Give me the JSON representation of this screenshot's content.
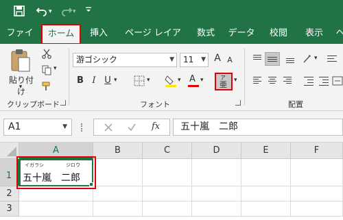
{
  "quick_access": {
    "save": "save-icon",
    "undo": "undo-icon",
    "redo": "redo-icon",
    "customize": "customize-qat-icon"
  },
  "tabs": [
    "ファイル",
    "ホーム",
    "挿入",
    "ページ レイアウト",
    "数式",
    "データ",
    "校閲",
    "表示",
    "ヘ"
  ],
  "ribbon": {
    "clipboard": {
      "paste_label": "貼り付け",
      "paste_arrow": "▾",
      "group_label": "クリップボード"
    },
    "font": {
      "font_name": "游ゴシック",
      "font_size": "11",
      "grow": "A",
      "shrink": "A",
      "bold": "B",
      "italic": "I",
      "underline": "U",
      "font_color_letter": "A",
      "group_label": "フォント",
      "phonetic_ruby": "ア",
      "phonetic_base": "亜"
    },
    "alignment": {
      "group_label": "配置"
    }
  },
  "formula_bar": {
    "name_box": "A1",
    "fx": "fx",
    "formula_text": "五十嵐　二郎"
  },
  "grid": {
    "columns": [
      "A",
      "B",
      "C",
      "D",
      "E",
      "F"
    ],
    "rows": [
      "1",
      "2",
      "3"
    ],
    "cell_a1": {
      "furigana_1": "イガラシ",
      "furigana_2": "ジロウ",
      "value": "五十嵐　二郎"
    }
  },
  "colors": {
    "accent": "#217346",
    "highlight": "#e00000",
    "font_color": "#e00000",
    "fill_color": "#ffe600"
  }
}
